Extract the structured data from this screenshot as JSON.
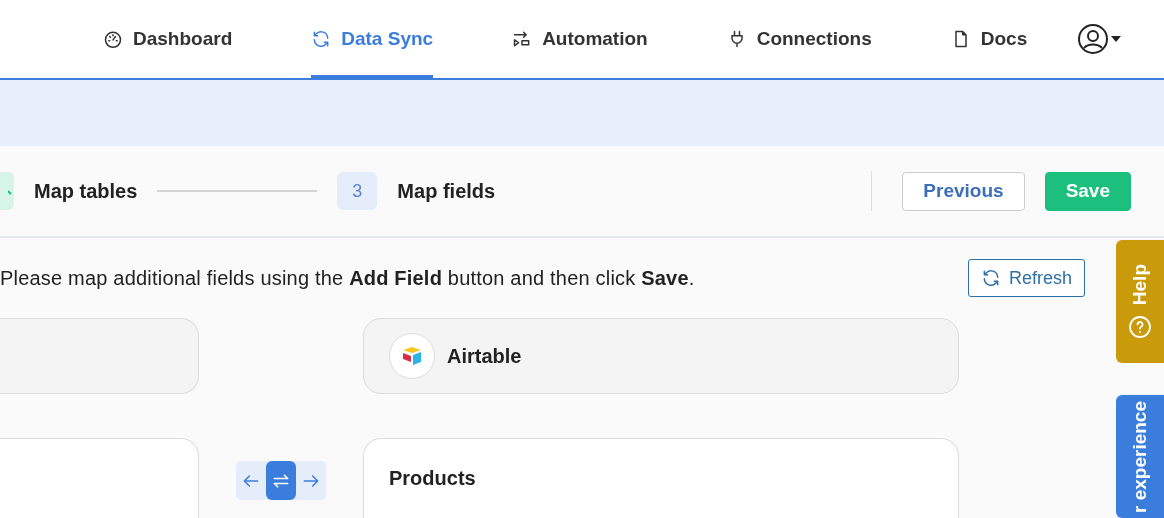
{
  "nav": {
    "items": [
      {
        "kind": "dashboard",
        "label": "Dashboard",
        "selected": false
      },
      {
        "kind": "sync",
        "label": "Data Sync",
        "selected": true
      },
      {
        "kind": "automation",
        "label": "Automation",
        "selected": false
      },
      {
        "kind": "connections",
        "label": "Connections",
        "selected": false
      },
      {
        "kind": "docs",
        "label": "Docs",
        "selected": false
      }
    ]
  },
  "stepper": {
    "steps": [
      {
        "completed": true,
        "label": "Map tables"
      },
      {
        "completed": false,
        "number": "3",
        "label": "Map fields"
      }
    ],
    "buttons": [
      {
        "kind": "secondary",
        "label": "Previous"
      },
      {
        "kind": "primary",
        "label": "Save"
      }
    ]
  },
  "instruction": "Please map additional fields using the **Add Field** button and then click **Save**.",
  "refresh_button": "Refresh",
  "destination": {
    "name": "Airtable"
  },
  "sync_direction": [
    {
      "kind": "left",
      "selected": false
    },
    {
      "kind": "both",
      "selected": true
    },
    {
      "kind": "right",
      "selected": false
    }
  ],
  "destination_table": "Products",
  "side_tabs": [
    {
      "kind": "help",
      "label": "Help"
    },
    {
      "kind": "feedback",
      "label": "r experience"
    }
  ]
}
